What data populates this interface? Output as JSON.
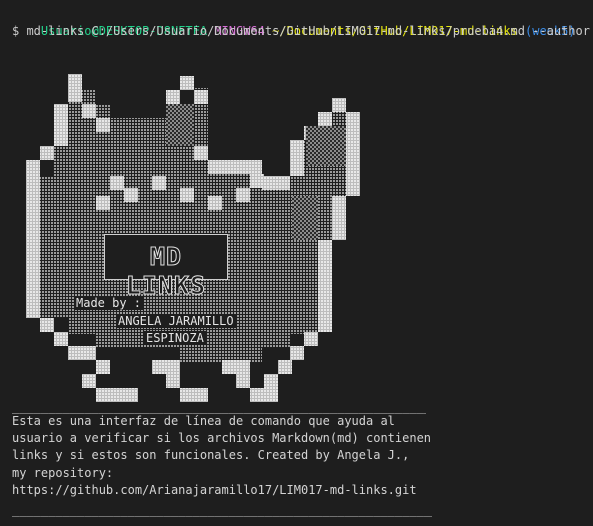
{
  "prompt": {
    "user_host": "Usuario@DESKTOP-D8NFTFA",
    "shell": "MINGW64",
    "path": "~/Documents/GitHub/LIM017-md-links",
    "branch": "(week5)"
  },
  "command": "$ md-links C:/Users/Usuario/Documents/GitHub/LIM017-md-links/prueba4.md --author",
  "art": {
    "logo_text": "MD LINKS",
    "made_by": "Made by :",
    "author_line1": "ANGELA JARAMILLO",
    "author_line2": "ESPINOZA"
  },
  "divider_top": "____________________________________________________________",
  "description": [
    "Esta es una interfaz de línea de comando que ayuda al",
    "usuario a verificar si los archivos Markdown(md) contienen",
    "links y si estos son funcionales. Created by Angela J.,",
    "my repository:",
    "https://github.com/Arianajaramillo17/LIM017-md-links.git"
  ],
  "divider_bottom": "____________________________________________________________",
  "colors": {
    "background": "#1e1e1e",
    "prompt_user": "#23d18b",
    "prompt_shell": "#d670d6",
    "prompt_path": "#e5e510",
    "prompt_branch": "#3b8eea",
    "text": "#cccccc"
  }
}
